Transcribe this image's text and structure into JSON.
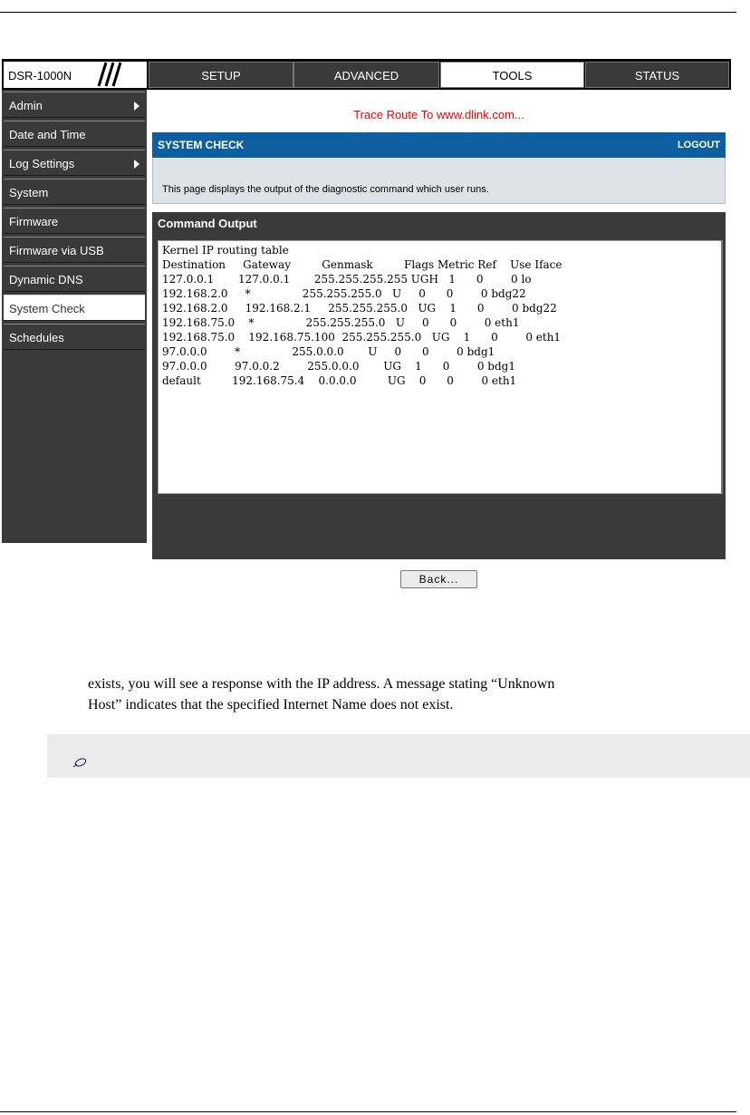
{
  "app": {
    "brand": "DSR-1000N",
    "tabs": [
      {
        "label": "SETUP"
      },
      {
        "label": "ADVANCED"
      },
      {
        "label": "TOOLS"
      },
      {
        "label": "STATUS"
      }
    ],
    "sidebar": [
      {
        "label": "Admin",
        "has_arrow": true
      },
      {
        "label": "Date and Time"
      },
      {
        "label": "Log Settings",
        "has_arrow": true
      },
      {
        "label": "System"
      },
      {
        "label": "Firmware"
      },
      {
        "label": "Firmware via USB"
      },
      {
        "label": "Dynamic DNS"
      },
      {
        "label": "System Check"
      },
      {
        "label": "Schedules"
      }
    ],
    "trace_message": "Trace Route To www.dlink.com...",
    "system_check": {
      "title": "SYSTEM CHECK",
      "logout": "LOGOUT",
      "description": "This page displays the output of the diagnostic command which user runs."
    },
    "command_output": {
      "title": "Command Output",
      "text": "Kernel IP routing table\nDestination     Gateway         Genmask         Flags Metric Ref    Use Iface\n127.0.0.1       127.0.0.1       255.255.255.255 UGH   1      0        0 lo\n192.168.2.0     *               255.255.255.0   U     0      0        0 bdg22\n192.168.2.0     192.168.2.1     255.255.255.0   UG    1      0        0 bdg22\n192.168.75.0    *               255.255.255.0   U     0      0        0 eth1\n192.168.75.0    192.168.75.100  255.255.255.0   UG    1      0        0 eth1\n97.0.0.0        *               255.0.0.0       U     0      0        0 bdg1\n97.0.0.0        97.0.0.2        255.0.0.0       UG    1      0        0 bdg1\ndefault         192.168.75.4    0.0.0.0         UG    0      0        0 eth1"
    },
    "back_button": "Back..."
  },
  "document": {
    "line1": "exists, you will see a response with the IP address. A message stating “Unknown",
    "line2": "Host” indicates that the specified Internet Name does not exist."
  }
}
